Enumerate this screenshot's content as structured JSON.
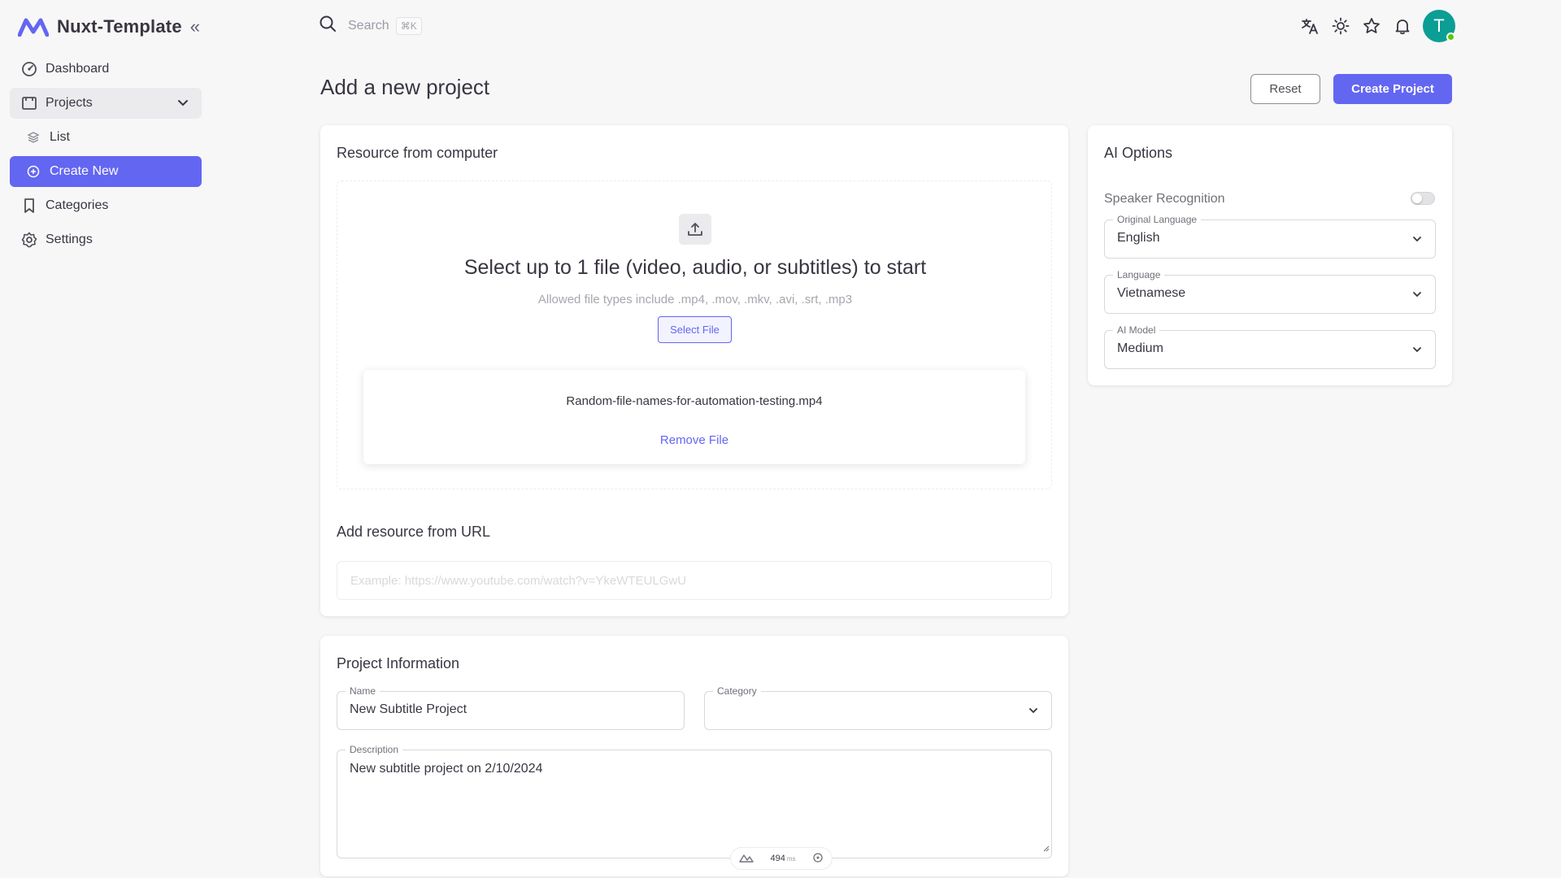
{
  "app": {
    "title": "Nuxt-Template",
    "brand_color": "#6366f1"
  },
  "sidebar": {
    "items": [
      {
        "label": "Dashboard",
        "icon": "dashboard-icon"
      },
      {
        "label": "Projects",
        "icon": "projects-icon",
        "expanded": true
      },
      {
        "label": "List",
        "icon": "layers-icon"
      },
      {
        "label": "Create New",
        "icon": "plus-circle-icon",
        "active": true
      },
      {
        "label": "Categories",
        "icon": "bookmark-icon"
      },
      {
        "label": "Settings",
        "icon": "gear-icon"
      }
    ]
  },
  "topbar": {
    "search_label": "Search",
    "search_shortcut": "⌘K",
    "icons": [
      "translate-icon",
      "sun-icon",
      "star-icon",
      "bell-icon"
    ],
    "avatar_letter": "T",
    "avatar_color": "#0b9e95"
  },
  "header": {
    "title": "Add a new project",
    "reset_label": "Reset",
    "create_label": "Create Project"
  },
  "resource": {
    "title": "Resource from computer",
    "headline": "Select up to 1 file (video, audio, or subtitles) to start",
    "allowed": "Allowed file types include .mp4, .mov, .mkv, .avi, .srt, .mp3",
    "select_label": "Select File",
    "file_name": "Random-file-names-for-automation-testing.mp4",
    "remove_label": "Remove File",
    "url_title": "Add resource from URL",
    "url_placeholder": "Example: https://www.youtube.com/watch?v=YkeWTEULGwU"
  },
  "project_info": {
    "title": "Project Information",
    "name_label": "Name",
    "name_value": "New Subtitle Project",
    "category_label": "Category",
    "category_value": "",
    "description_label": "Description",
    "description_value": "New subtitle project on 2/10/2024"
  },
  "ai_options": {
    "title": "AI Options",
    "speaker_label": "Speaker Recognition",
    "speaker_enabled": false,
    "original_language_label": "Original Language",
    "original_language_value": "English",
    "language_label": "Language",
    "language_value": "Vietnamese",
    "model_label": "AI Model",
    "model_value": "Medium"
  },
  "devtools": {
    "timing": "494",
    "unit": "ms"
  }
}
